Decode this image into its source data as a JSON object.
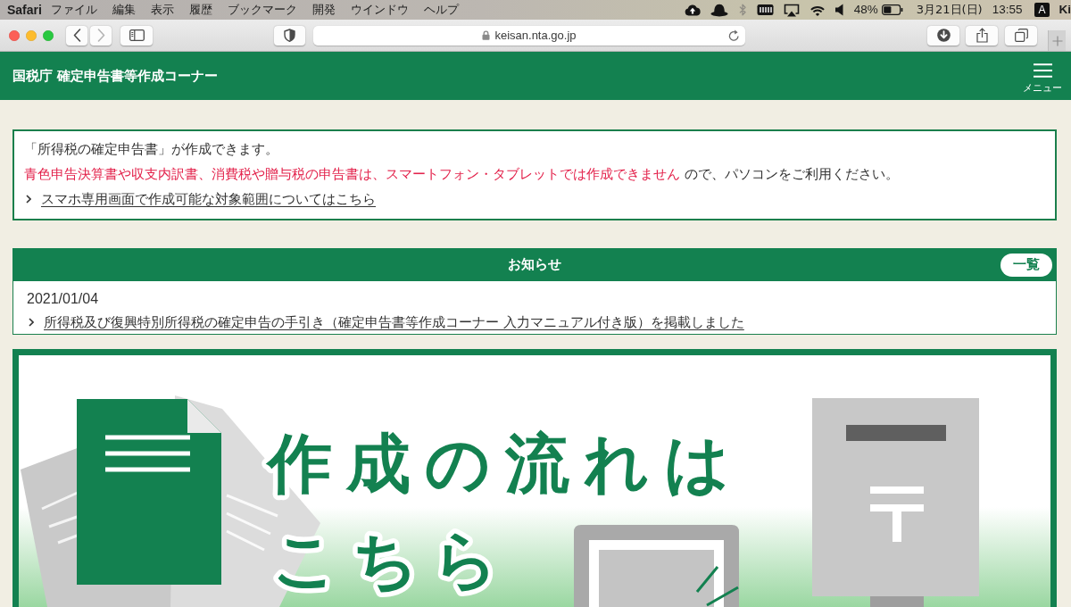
{
  "menubar": {
    "app": "Safari",
    "menus": [
      "ファイル",
      "編集",
      "表示",
      "履歴",
      "ブックマーク",
      "開発",
      "ウインドウ",
      "ヘルプ"
    ],
    "bluetooth": {
      "on": false
    },
    "battery_percent": "48%",
    "date": "3月21日(日)",
    "time": "13:55",
    "input_source": "A",
    "user": "Ki"
  },
  "browser": {
    "can_go_back": true,
    "can_go_forward": false,
    "url": "keisan.nta.go.jp"
  },
  "site_header": {
    "title": "国税庁 確定申告書等作成コーナー",
    "menu_label": "メニュー"
  },
  "notice": {
    "intro": "「所得税の確定申告書」が作成できます。",
    "warning": {
      "emphasis": "青色申告決算書や収支内訳書、消費税や贈与税の申告書は、スマートフォン・タブレットでは作成できません",
      "rest": "ので、パソコンをご利用ください。"
    },
    "link": "スマホ専用画面で作成可能な対象範囲についてはこちら"
  },
  "news": {
    "title": "お知らせ",
    "list_button": "一覧",
    "items": [
      {
        "date": "2021/01/04",
        "link": "所得税及び復興特別所得税の確定申告の手引き（確定申告書等作成コーナー 入力マニュアル付き版）を掲載しました"
      }
    ]
  },
  "banner": {
    "title_lines": [
      "作成の流れは",
      "こちら"
    ]
  }
}
